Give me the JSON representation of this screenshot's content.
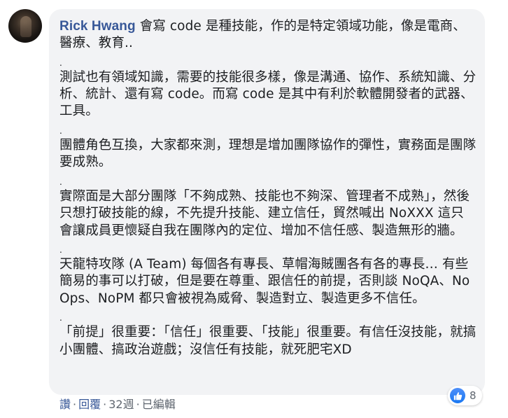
{
  "author": {
    "name": "Rick Hwang"
  },
  "comment": {
    "paragraphs": [
      "會寫 code 是種技能，作的是特定領域功能，像是電商、醫療、教育..",
      "測試也有領域知識，需要的技能很多樣，像是溝通、協作、系統知識、分析、統計、還有寫 code。而寫 code 是其中有利於軟體開發者的武器、工具。",
      "團體角色互換，大家都來測，理想是增加團隊協作的彈性，實務面是團隊要成熟。",
      "實際面是大部分團隊「不夠成熟、技能也不夠深、管理者不成熟」，然後只想打破技能的線，不先提升技能、建立信任，貿然喊出 NoXXX 這只會讓成員更懷疑自我在團隊內的定位、增加不信任感、製造無形的牆。",
      "天龍特攻隊 (A Team) 每個各有專長、草帽海賊團各有各的專長… 有些簡易的事可以打破，但是要在尊重、跟信任的前提，否則談 NoQA、NoOps、NoPM 都只會被視為威脅、製造對立、製造更多不信任。",
      "「前提」很重要：「信任」很重要、「技能」很重要。有信任沒技能，就搞小團體、搞政治遊戲；沒信任有技能，就死肥宅XD"
    ],
    "separator": "."
  },
  "actions": {
    "like": "讚",
    "reply": "回覆",
    "time": "32週",
    "edited": "已編輯",
    "separator": "·"
  },
  "reactions": {
    "icon": "thumbs-up-icon",
    "count": "8",
    "color": "#1877f2"
  },
  "colors": {
    "author_link": "#385898",
    "bubble_bg": "#f2f3f5",
    "meta_text": "#606770"
  }
}
